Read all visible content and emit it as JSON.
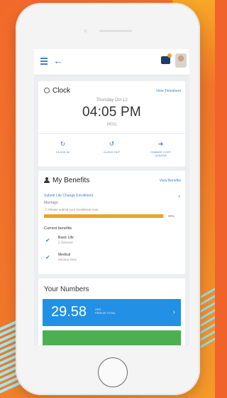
{
  "header": {
    "back_glyph": "←"
  },
  "clock": {
    "title": "Clock",
    "link": "View Timesheet",
    "date": "Thursday Oct 12",
    "time": "04:05 PM",
    "sub": "[4511]",
    "actions": [
      {
        "label": "CLOCK IN",
        "icon": "clock-in-icon",
        "glyph": "↻"
      },
      {
        "label": "CLOCK OUT",
        "icon": "clock-out-icon",
        "glyph": "↺"
      },
      {
        "label": "CHANGE COST CENTER",
        "icon": "arrow-right-icon",
        "glyph": "➜"
      }
    ]
  },
  "benefits": {
    "title": "My Benefits",
    "link": "View Benefits",
    "enrollment_link": "Submit Life Change Enrollment",
    "enrollment_type": "Marriage",
    "notice": "Please submit your enrollment now.",
    "progress_percent": 99,
    "progress_label": "99%",
    "current_heading": "Current benefits",
    "items": [
      {
        "name": "Basic Life",
        "detail": "2 selected"
      },
      {
        "name": "Medical",
        "detail": "Medical New"
      }
    ],
    "accent": "#f1a126"
  },
  "numbers": {
    "title": "Your Numbers",
    "value": "29.58",
    "unit_line1": "HRS",
    "unit_line2": "PERIOD TOTAL",
    "tile_color": "#2190e5"
  }
}
